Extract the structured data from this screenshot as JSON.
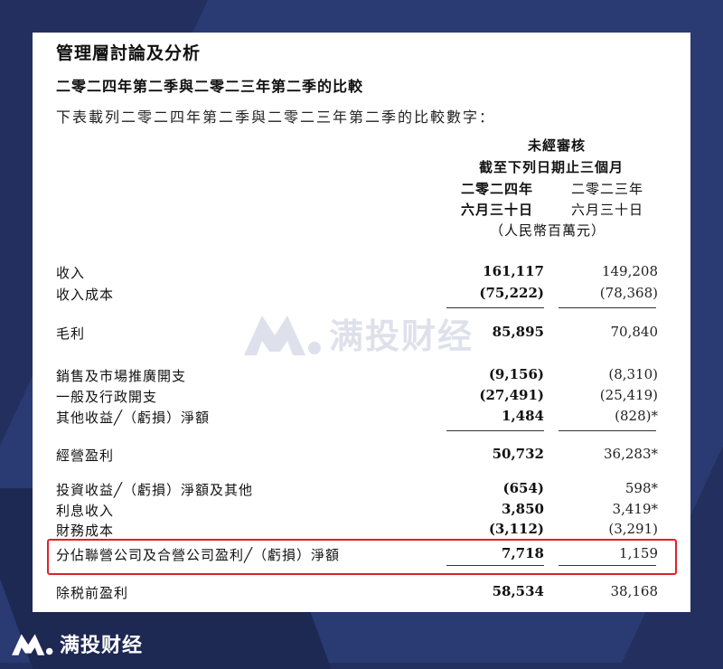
{
  "doc": {
    "title": "管理層討論及分析",
    "subtitle": "二零二四年第二季與二零二三年第二季的比較",
    "intro": "下表載列二零二四年第二季與二零二三年第二季的比較數字："
  },
  "header": {
    "audit": "未經審核",
    "period": "截至下列日期止三個月",
    "col1_year": "二零二四年",
    "col2_year": "二零二三年",
    "col1_date": "六月三十日",
    "col2_date": "六月三十日",
    "unit": "（人民幣百萬元）"
  },
  "rows": [
    {
      "label": "收入",
      "v2024": "161,117",
      "v2023": "149,208"
    },
    {
      "label": "收入成本",
      "v2024": "(75,222)",
      "v2023": "(78,368)"
    },
    {
      "label": "毛利",
      "v2024": "85,895",
      "v2023": "70,840"
    },
    {
      "label": "銷售及市場推廣開支",
      "v2024": "(9,156)",
      "v2023": "(8,310)"
    },
    {
      "label": "一般及行政開支",
      "v2024": "(27,491)",
      "v2023": "(25,419)"
    },
    {
      "label": "其他收益╱（虧損）淨額",
      "v2024": "1,484",
      "v2023": "(828)*"
    },
    {
      "label": "經營盈利",
      "v2024": "50,732",
      "v2023": "36,283*"
    },
    {
      "label": "投資收益╱（虧損）淨額及其他",
      "v2024": "(654)",
      "v2023": "598*"
    },
    {
      "label": "利息收入",
      "v2024": "3,850",
      "v2023": "3,419*"
    },
    {
      "label": "財務成本",
      "v2024": "(3,112)",
      "v2023": "(3,291)"
    },
    {
      "label": "分佔聯營公司及合營公司盈利╱（虧損）淨額",
      "v2024": "7,718",
      "v2023": "1,159"
    },
    {
      "label": "除税前盈利",
      "v2024": "58,534",
      "v2023": "38,168"
    }
  ],
  "watermark": {
    "text": "满投财经"
  },
  "brand": {
    "text": "满投财经",
    "highlight_color": "#e0202a"
  }
}
